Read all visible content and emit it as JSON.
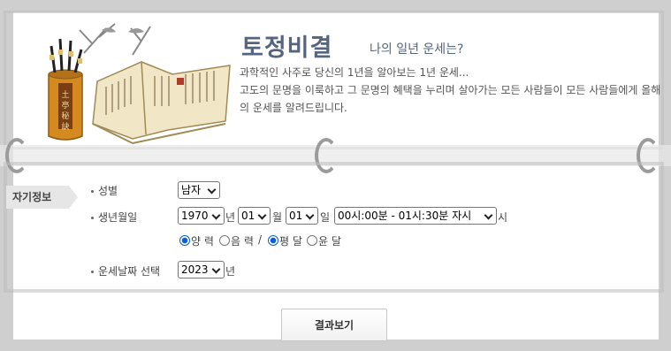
{
  "header": {
    "title": "토정비결",
    "subtitle": "나의 일년 운세는?",
    "desc_line1": "과학적인 사주로 당신의 1년을 알아보는 1년 운세...",
    "desc_line2": "고도의 문명을 이룩하고 그 문명의 혜택을 누리며 살아가는 모든 사람들이 모든 사람들에게 올해의 운세를 알려드립니다."
  },
  "image": {
    "pot_text": "土亭秘訣"
  },
  "section_tag": "자기정보",
  "form": {
    "gender_label": "성별",
    "gender_value": "남자",
    "birth_label": "생년월일",
    "year_value": "1970",
    "year_unit": "년",
    "month_value": "01",
    "month_unit": "월",
    "day_value": "01",
    "day_unit": "일",
    "time_value": "00시:00분 - 01시:30분 자시",
    "time_unit": "시",
    "calendar_solar": "양 력",
    "calendar_lunar": "음 력",
    "separator": "/",
    "month_normal": "평 달",
    "month_leap": "윤 달",
    "fortune_date_label": "운세날짜 선택",
    "fortune_year_value": "2023",
    "fortune_year_unit": "년"
  },
  "submit_label": "결과보기",
  "colors": {
    "title": "#55647f",
    "radio_accent": "#0a5fd8"
  }
}
